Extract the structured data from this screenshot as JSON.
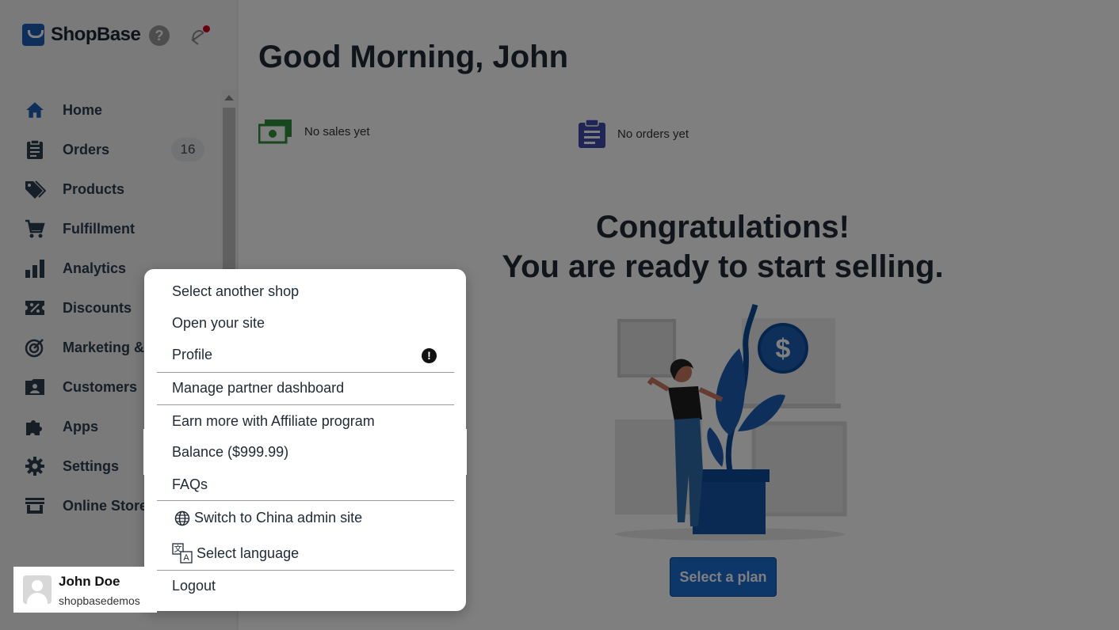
{
  "brand": {
    "name": "ShopBase",
    "accent": "#1a5fb4"
  },
  "header": {
    "help_icon": "help-icon",
    "notifications_icon": "bell-icon"
  },
  "sidebar": {
    "items": [
      {
        "label": "Home",
        "icon": "home-icon",
        "active": true
      },
      {
        "label": "Orders",
        "icon": "orders-icon",
        "badge": "16"
      },
      {
        "label": "Products",
        "icon": "tags-icon"
      },
      {
        "label": "Fulfillment",
        "icon": "cart-icon"
      },
      {
        "label": "Analytics",
        "icon": "bar-chart-icon"
      },
      {
        "label": "Discounts",
        "icon": "discount-icon"
      },
      {
        "label": "Marketing & Sales",
        "icon": "target-icon"
      },
      {
        "label": "Customers",
        "icon": "customers-icon"
      },
      {
        "label": "Apps",
        "icon": "puzzle-icon"
      },
      {
        "label": "Settings",
        "icon": "gear-icon"
      },
      {
        "label": "Online Store",
        "icon": "store-icon"
      }
    ]
  },
  "main": {
    "greeting": "Good Morning, John",
    "stats": [
      {
        "label": "No sales yet",
        "icon": "money-icon"
      },
      {
        "label": "No orders yet",
        "icon": "clipboard-icon"
      }
    ],
    "congrats_line1": "Congratulations!",
    "congrats_line2": "You are ready to start selling.",
    "cta": "Select a plan"
  },
  "account_menu": {
    "items": [
      "Select another shop",
      "Open your site",
      "Profile",
      "Manage partner dashboard",
      "Earn more with Affiliate program",
      "Balance ($999.99)",
      "FAQs",
      "Switch to China admin site",
      "Select language",
      "Logout"
    ]
  },
  "user": {
    "name": "John Doe",
    "shop": "shopbasedemos"
  }
}
